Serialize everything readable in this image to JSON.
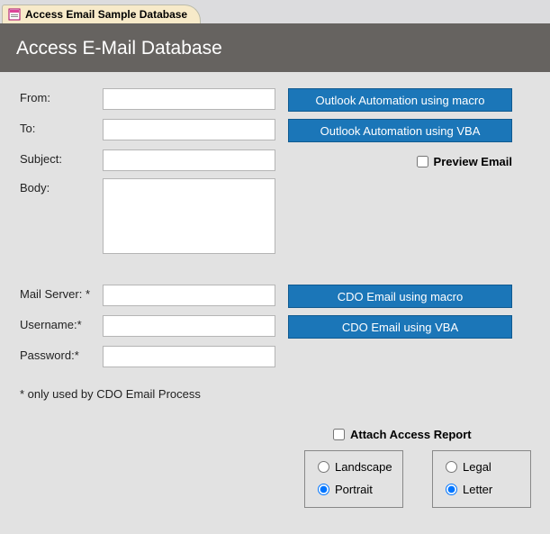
{
  "tab": {
    "title": "Access Email Sample Database"
  },
  "header": {
    "title": "Access E-Mail Database"
  },
  "fields": {
    "from": {
      "label": "From:",
      "value": ""
    },
    "to": {
      "label": "To:",
      "value": ""
    },
    "subject": {
      "label": "Subject:",
      "value": ""
    },
    "body": {
      "label": "Body:",
      "value": ""
    },
    "mailserver": {
      "label": "Mail Server: *",
      "value": ""
    },
    "username": {
      "label": "Username:*",
      "value": ""
    },
    "password": {
      "label": "Password:*",
      "value": ""
    }
  },
  "buttons": {
    "outlook_macro": "Outlook Automation using macro",
    "outlook_vba": "Outlook Automation using VBA",
    "cdo_macro": "CDO Email using macro",
    "cdo_vba": "CDO Email using VBA"
  },
  "checkboxes": {
    "preview": "Preview Email",
    "attach": "Attach Access Report"
  },
  "note": "* only used by CDO Email Process",
  "options": {
    "orientation": {
      "landscape": "Landscape",
      "portrait": "Portrait",
      "selected": "portrait"
    },
    "paper": {
      "legal": "Legal",
      "letter": "Letter",
      "selected": "letter"
    }
  }
}
